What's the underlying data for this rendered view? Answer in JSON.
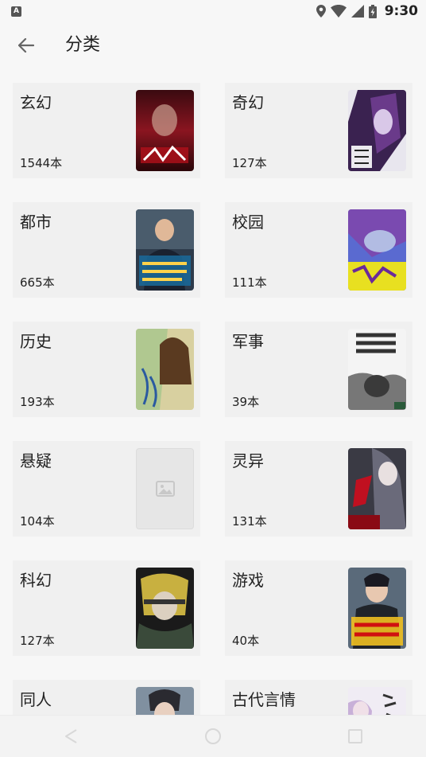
{
  "status_bar": {
    "notification_glyph": "A",
    "time": "9:30"
  },
  "app_bar": {
    "back_icon": "arrow-left-icon",
    "title": "分类"
  },
  "categories": [
    {
      "name": "玄幻",
      "count": "1544本",
      "cover": "book-cover-image"
    },
    {
      "name": "奇幻",
      "count": "127本",
      "cover": "book-cover-image"
    },
    {
      "name": "都市",
      "count": "665本",
      "cover": "book-cover-image"
    },
    {
      "name": "校园",
      "count": "111本",
      "cover": "book-cover-image"
    },
    {
      "name": "历史",
      "count": "193本",
      "cover": "book-cover-image"
    },
    {
      "name": "军事",
      "count": "39本",
      "cover": "book-cover-image"
    },
    {
      "name": "悬疑",
      "count": "104本",
      "cover": "image-placeholder-icon"
    },
    {
      "name": "灵异",
      "count": "131本",
      "cover": "book-cover-image"
    },
    {
      "name": "科幻",
      "count": "127本",
      "cover": "book-cover-image"
    },
    {
      "name": "游戏",
      "count": "40本",
      "cover": "book-cover-image"
    },
    {
      "name": "同人",
      "count": "",
      "cover": "book-cover-image"
    },
    {
      "name": "古代言情",
      "count": "",
      "cover": "book-cover-image"
    }
  ],
  "colors": {
    "background": "#f7f7f7",
    "card_background": "#f0f0f0",
    "text": "#222222"
  },
  "nav_bar": {
    "back": "triangle-back-icon",
    "home": "circle-home-icon",
    "recents": "square-recents-icon"
  }
}
